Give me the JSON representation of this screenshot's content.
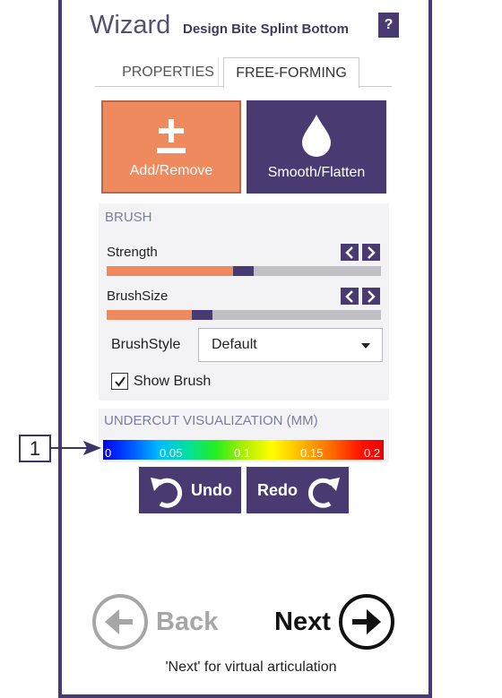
{
  "wizard": {
    "title": "Wizard",
    "subtitle": "Design Bite Splint Bottom",
    "help_label": "?"
  },
  "tabs": [
    {
      "label": "PROPERTIES",
      "active": false
    },
    {
      "label": "FREE-FORMING",
      "active": true
    }
  ],
  "modes": {
    "add_remove": {
      "label": "Add/Remove",
      "icon": "plus-minus-icon",
      "selected": true
    },
    "smooth_flatten": {
      "label": "Smooth/Flatten",
      "icon": "droplet-icon",
      "selected": false
    }
  },
  "brush": {
    "header": "BRUSH",
    "strength": {
      "label": "Strength",
      "value": 0.46
    },
    "brush_size": {
      "label": "BrushSize",
      "value": 0.31
    },
    "style": {
      "label": "BrushStyle",
      "value": "Default"
    },
    "show_brush": {
      "label": "Show Brush",
      "checked": true
    }
  },
  "undercut": {
    "header": "UNDERCUT VISUALIZATION (MM)",
    "ticks": [
      "0",
      "0.05",
      "0.1",
      "0.15",
      "0.2"
    ]
  },
  "callout_label": "1",
  "actions": {
    "undo": "Undo",
    "redo": "Redo"
  },
  "navigation": {
    "back": "Back",
    "next": "Next",
    "hint": "'Next' for virtual articulation"
  },
  "colors": {
    "accent": "#4a3a72",
    "orange": "#ee8a5e",
    "disabled": "#a6a6a6"
  }
}
